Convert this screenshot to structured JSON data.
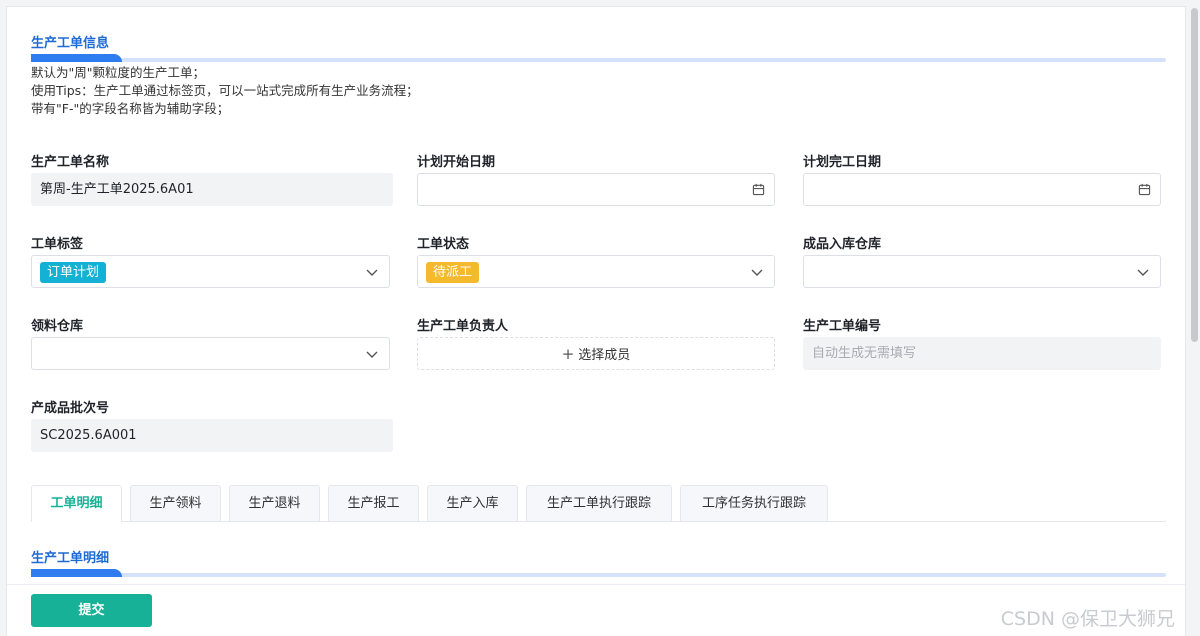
{
  "header_section": {
    "title": "生产工单信息"
  },
  "description": [
    "默认为\"周\"颗粒度的生产工单；",
    "使用Tips：生产工单通过标签页，可以一站式完成所有生产业务流程；",
    "带有\"F-\"的字段名称皆为辅助字段；"
  ],
  "fields": {
    "order_name": {
      "label": "生产工单名称",
      "value": "第周-生产工单2025.6A01"
    },
    "plan_start": {
      "label": "计划开始日期",
      "value": ""
    },
    "plan_finish": {
      "label": "计划完工日期",
      "value": ""
    },
    "order_tag": {
      "label": "工单标签",
      "value": "订单计划",
      "color": "#14b1d4"
    },
    "order_status": {
      "label": "工单状态",
      "value": "待派工",
      "color": "#f4b92c"
    },
    "product_warehouse": {
      "label": "成品入库仓库",
      "value": ""
    },
    "material_warehouse": {
      "label": "领料仓库",
      "value": ""
    },
    "owner": {
      "label": "生产工单负责人",
      "button_label": "选择成员"
    },
    "order_number": {
      "label": "生产工单编号",
      "placeholder": "自动生成无需填写"
    },
    "batch_number": {
      "label": "产成品批次号",
      "value": "SC2025.6A001"
    }
  },
  "tabs": [
    "工单明细",
    "生产领料",
    "生产退料",
    "生产报工",
    "生产入库",
    "生产工单执行跟踪",
    "工序任务执行跟踪"
  ],
  "active_tab": "工单明细",
  "detail_section": {
    "title": "生产工单明细"
  },
  "footer": {
    "submit_label": "提交"
  },
  "watermark": "CSDN @保卫大狮兄",
  "colors": {
    "accent": "#17b197",
    "section_blue": "#2f7cf0"
  }
}
